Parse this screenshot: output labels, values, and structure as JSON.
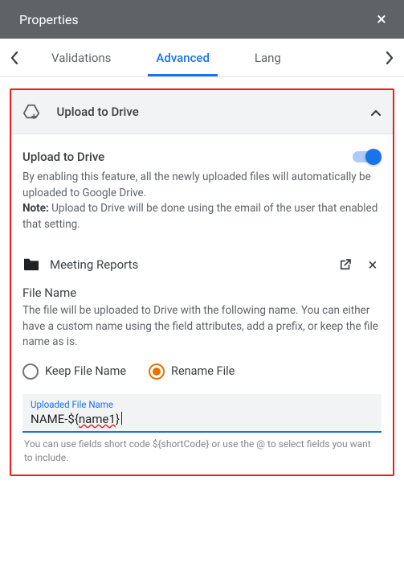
{
  "header": {
    "title": "Properties"
  },
  "tabs": {
    "items": [
      "Validations",
      "Advanced",
      "Lang"
    ],
    "active_index": 1
  },
  "section": {
    "title": "Upload to Drive",
    "toggle": {
      "label": "Upload to Drive",
      "on": true
    },
    "description": "By enabling this feature, all the newly uploaded files will automatically be uploaded to Google Drive.",
    "note_label": "Note:",
    "note_text": "Upload to Drive will be done using the email of the user that enabled that setting.",
    "folder": {
      "name": "Meeting Reports"
    },
    "filename_header": "File Name",
    "filename_desc": "The file will be uploaded to Drive with the following name. You can either have a custom name using the field attributes, add a prefix, or keep the file name as is.",
    "radios": {
      "keep": "Keep File Name",
      "rename": "Rename File",
      "selected": "rename"
    },
    "input": {
      "label": "Uploaded File Name",
      "value_prefix": "NAME-${",
      "value_mid": "name1",
      "value_suffix": "}"
    },
    "hint": "You can use fields short code ${shortCode} or use the @ to select fields you want to include."
  }
}
